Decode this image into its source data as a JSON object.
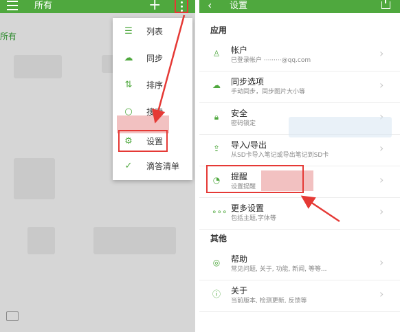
{
  "left": {
    "title": "所有",
    "section_label": "所有",
    "menu": {
      "items": [
        {
          "label": "列表",
          "icon": "list-icon"
        },
        {
          "label": "同步",
          "icon": "sync-cloud-icon"
        },
        {
          "label": "排序",
          "icon": "sort-icon"
        },
        {
          "label": "搜索",
          "icon": "search-icon"
        },
        {
          "label": "设置",
          "icon": "gear-icon"
        },
        {
          "label": "滴答清单",
          "icon": "check-circle-icon"
        }
      ]
    }
  },
  "right": {
    "title": "设置",
    "groups": [
      {
        "label": "应用",
        "rows": [
          {
            "title": "帐户",
            "subtitle": "已登录帐户 ·········@qq.com",
            "icon": "user-icon"
          },
          {
            "title": "同步选项",
            "subtitle": "手动同步，同步图片大小等",
            "icon": "sync-cloud-icon"
          },
          {
            "title": "安全",
            "subtitle": "密码锁定",
            "icon": "lock-icon"
          },
          {
            "title": "导入/导出",
            "subtitle": "从SD卡导入笔记或导出笔记到SD卡",
            "icon": "import-export-icon"
          },
          {
            "title": "提醒",
            "subtitle": "设置提醒",
            "icon": "reminder-icon"
          },
          {
            "title": "更多设置",
            "subtitle": "包括主题,字体等",
            "icon": "more-dots-icon"
          }
        ]
      },
      {
        "label": "其他",
        "rows": [
          {
            "title": "帮助",
            "subtitle": "常见问题, 关于, 功能, 新闻, 等等...",
            "icon": "help-lifebuoy-icon"
          },
          {
            "title": "关于",
            "subtitle": "当前版本, 检测更新, 反馈等",
            "icon": "info-icon"
          }
        ]
      }
    ]
  },
  "colors": {
    "brand_green": "#4fa83e",
    "annotation_red": "#e53935"
  }
}
